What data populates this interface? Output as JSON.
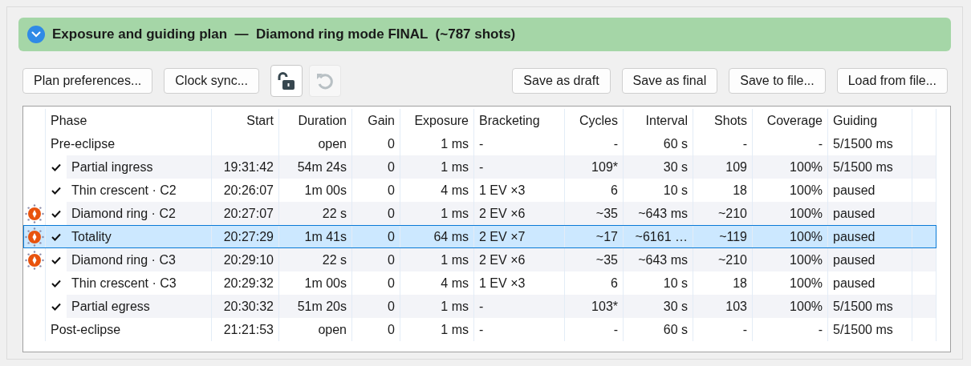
{
  "header": {
    "title": "Exposure and guiding plan  —  Diamond ring mode FINAL  (~787 shots)",
    "expanded": true
  },
  "toolbar": {
    "left_buttons": [
      "Plan preferences...",
      "Clock sync..."
    ],
    "locked": false,
    "undo_disabled": true,
    "right_buttons": [
      "Save as draft",
      "Save as final",
      "Save to file...",
      "Load from file..."
    ]
  },
  "table": {
    "columns": [
      "Phase",
      "Start",
      "Duration",
      "Gain",
      "Exposure",
      "Bracketing",
      "Cycles",
      "Interval",
      "Shots",
      "Coverage",
      "Guiding"
    ],
    "rows": [
      {
        "cells": [
          "Pre-eclipse",
          "",
          "open",
          "0",
          "1 ms",
          "-",
          "-",
          "60 s",
          "-",
          "-",
          "5/1500 ms"
        ],
        "checked": false,
        "flagged": false,
        "selected": false
      },
      {
        "cells": [
          "Partial ingress",
          "19:31:42",
          "54m 24s",
          "0",
          "1 ms",
          "-",
          "109*",
          "30 s",
          "109",
          "100%",
          "5/1500 ms"
        ],
        "checked": true,
        "flagged": false,
        "selected": false
      },
      {
        "cells": [
          "Thin crescent · C2",
          "20:26:07",
          "1m 00s",
          "0",
          "4 ms",
          "1 EV ×3",
          "6",
          "10 s",
          "18",
          "100%",
          "paused"
        ],
        "checked": true,
        "flagged": false,
        "selected": false
      },
      {
        "cells": [
          "Diamond ring · C2",
          "20:27:07",
          "22 s",
          "0",
          "1 ms",
          "2 EV ×6",
          "~35",
          "~643 ms",
          "~210",
          "100%",
          "paused"
        ],
        "checked": true,
        "flagged": true,
        "selected": false
      },
      {
        "cells": [
          "Totality",
          "20:27:29",
          "1m 41s",
          "0",
          "64 ms",
          "2 EV ×7",
          "~17",
          "~6161 …",
          "~119",
          "100%",
          "paused"
        ],
        "checked": true,
        "flagged": true,
        "selected": true
      },
      {
        "cells": [
          "Diamond ring · C3",
          "20:29:10",
          "22 s",
          "0",
          "1 ms",
          "2 EV ×6",
          "~35",
          "~643 ms",
          "~210",
          "100%",
          "paused"
        ],
        "checked": true,
        "flagged": true,
        "selected": false
      },
      {
        "cells": [
          "Thin crescent · C3",
          "20:29:32",
          "1m 00s",
          "0",
          "4 ms",
          "1 EV ×3",
          "6",
          "10 s",
          "18",
          "100%",
          "paused"
        ],
        "checked": true,
        "flagged": false,
        "selected": false
      },
      {
        "cells": [
          "Partial egress",
          "20:30:32",
          "51m 20s",
          "0",
          "1 ms",
          "-",
          "103*",
          "30 s",
          "103",
          "100%",
          "5/1500 ms"
        ],
        "checked": true,
        "flagged": false,
        "selected": false
      },
      {
        "cells": [
          "Post-eclipse",
          "21:21:53",
          "open",
          "0",
          "1 ms",
          "-",
          "-",
          "60 s",
          "-",
          "-",
          "5/1500 ms"
        ],
        "checked": false,
        "flagged": false,
        "selected": false
      }
    ]
  }
}
